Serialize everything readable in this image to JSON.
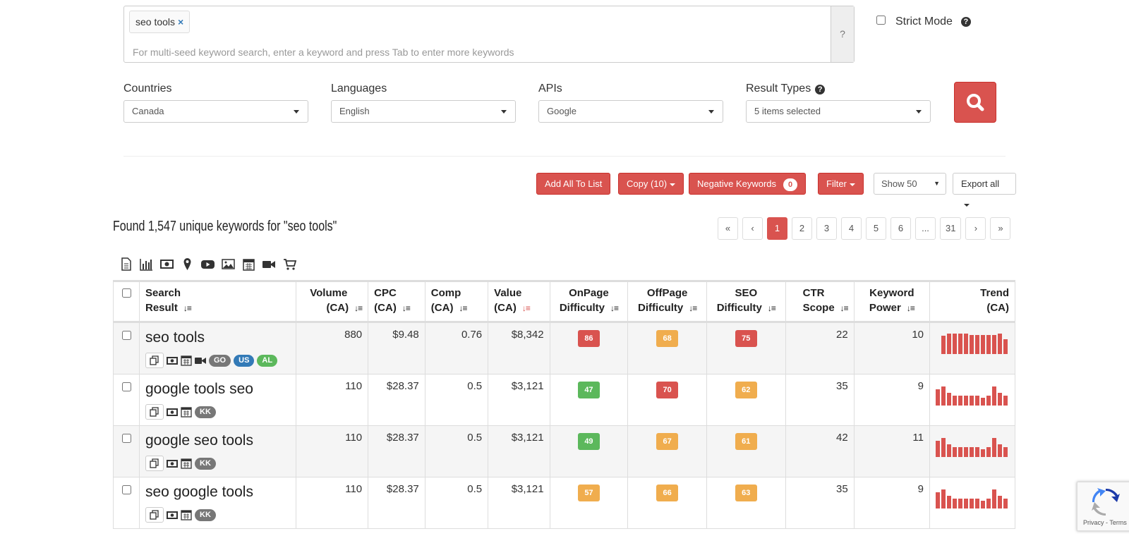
{
  "search": {
    "tag": "seo tools",
    "tag_remove": "×",
    "placeholder": "For multi-seed keyword search, enter a keyword and press Tab to enter more keywords",
    "help": "?"
  },
  "strict_mode": {
    "label": "Strict Mode",
    "help": "?"
  },
  "filters": {
    "countries": {
      "label": "Countries",
      "value": "Canada"
    },
    "languages": {
      "label": "Languages",
      "value": "English"
    },
    "apis": {
      "label": "APIs",
      "value": "Google"
    },
    "result_types": {
      "label": "Result Types",
      "value": "5 items selected",
      "help": "?"
    }
  },
  "toolbar": {
    "add_all": "Add All To List",
    "copy": "Copy (10)",
    "negative_keywords": "Negative Keywords",
    "negative_count": "0",
    "filter": "Filter",
    "show": "Show 50",
    "show_arrow": "▼",
    "export": "Export all"
  },
  "found_text": "Found 1,547 unique keywords for \"seo tools\"",
  "pagination": [
    "«",
    "‹",
    "1",
    "2",
    "3",
    "4",
    "5",
    "6",
    "...",
    "31",
    "›",
    "»"
  ],
  "pagination_active": "1",
  "icon_strip": [
    "document-icon",
    "bar-chart-icon",
    "money-icon",
    "map-pin-icon",
    "youtube-icon",
    "image-icon",
    "calendar-icon",
    "video-camera-icon",
    "shopping-cart-icon"
  ],
  "table": {
    "headers": {
      "search_result": [
        "Search",
        "Result"
      ],
      "volume": [
        "Volume",
        "(CA)"
      ],
      "cpc": [
        "CPC",
        "(CA)"
      ],
      "comp": [
        "Comp",
        "(CA)"
      ],
      "value": [
        "Value",
        "(CA)"
      ],
      "onpage": [
        "OnPage",
        "Difficulty"
      ],
      "offpage": [
        "OffPage",
        "Difficulty"
      ],
      "seo": [
        "SEO",
        "Difficulty"
      ],
      "ctr": [
        "CTR",
        "Scope"
      ],
      "power": [
        "Keyword",
        "Power"
      ],
      "trend": [
        "Trend",
        "(CA)"
      ]
    },
    "rows": [
      {
        "keyword": "seo tools",
        "volume": "880",
        "cpc": "$9.48",
        "comp": "0.76",
        "value": "$8,342",
        "onpage": "86",
        "offpage": "68",
        "seo": "75",
        "ctr": "22",
        "power": "10",
        "badges": [
          "GO",
          "US",
          "AL"
        ],
        "trend": [
          0.85,
          0.95,
          0.95,
          0.95,
          0.95,
          0.9,
          0.9,
          0.9,
          0.9,
          0.9,
          0.95,
          0.7
        ]
      },
      {
        "keyword": "google tools seo",
        "volume": "110",
        "cpc": "$28.37",
        "comp": "0.5",
        "value": "$3,121",
        "onpage": "47",
        "offpage": "70",
        "seo": "62",
        "ctr": "35",
        "power": "9",
        "badges": [
          "KK"
        ],
        "trend": [
          0.75,
          0.9,
          0.6,
          0.45,
          0.45,
          0.45,
          0.45,
          0.45,
          0.35,
          0.45,
          0.9,
          0.6,
          0.45
        ]
      },
      {
        "keyword": "google seo tools",
        "volume": "110",
        "cpc": "$28.37",
        "comp": "0.5",
        "value": "$3,121",
        "onpage": "49",
        "offpage": "67",
        "seo": "61",
        "ctr": "42",
        "power": "11",
        "badges": [
          "KK"
        ],
        "trend": [
          0.75,
          0.9,
          0.6,
          0.45,
          0.45,
          0.45,
          0.45,
          0.45,
          0.35,
          0.45,
          0.9,
          0.6,
          0.45
        ]
      },
      {
        "keyword": "seo google tools",
        "volume": "110",
        "cpc": "$28.37",
        "comp": "0.5",
        "value": "$3,121",
        "onpage": "57",
        "offpage": "66",
        "seo": "63",
        "ctr": "35",
        "power": "9",
        "badges": [
          "KK"
        ],
        "trend": [
          0.75,
          0.9,
          0.6,
          0.45,
          0.45,
          0.45,
          0.45,
          0.45,
          0.35,
          0.45,
          0.9,
          0.6,
          0.45
        ]
      }
    ]
  },
  "colors": {
    "accent_red": "#d9534f",
    "warning_orange": "#f0ad4e",
    "success_green": "#5cb85c",
    "pill_gray": "#777777",
    "pill_blue": "#337ab7"
  },
  "recaptcha": {
    "text": "Privacy - Terms"
  }
}
